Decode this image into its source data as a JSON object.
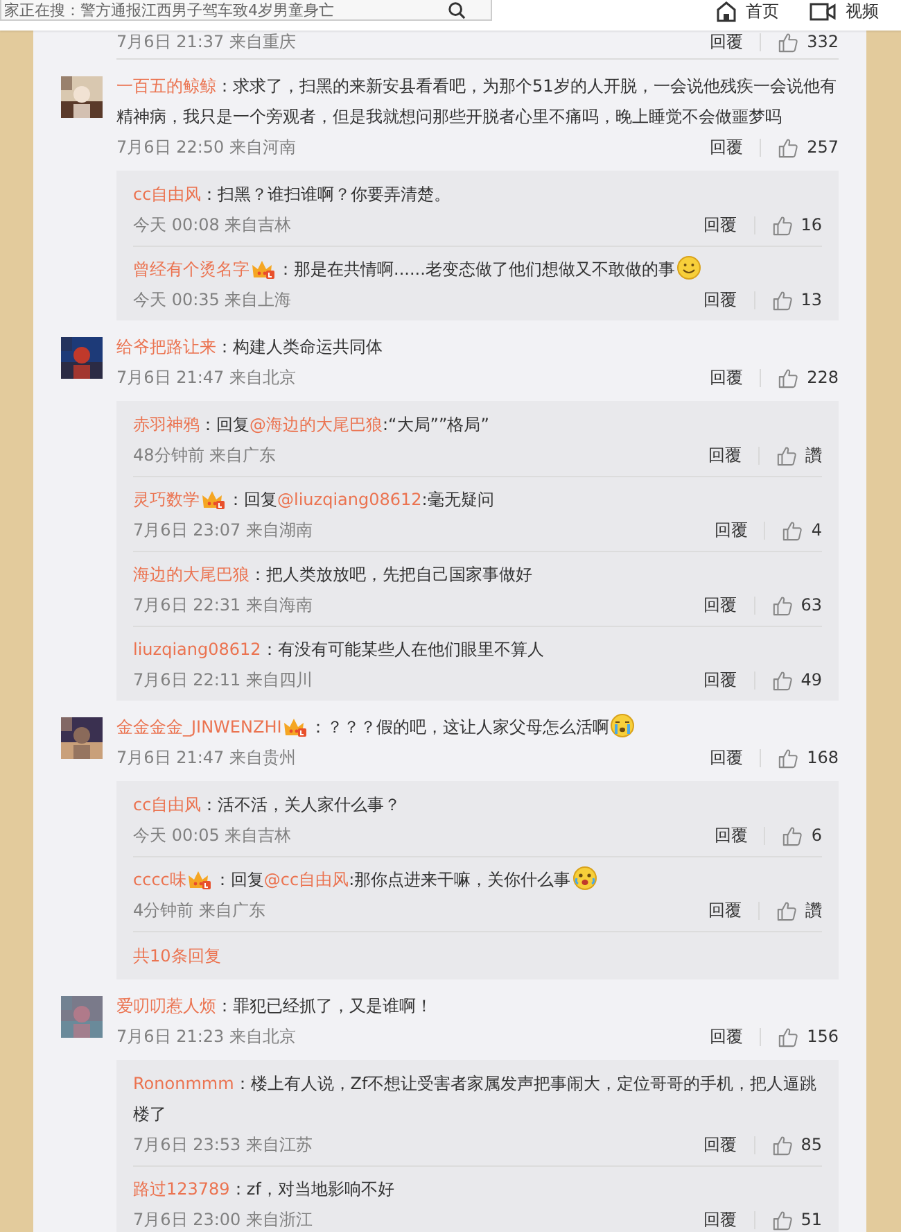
{
  "header": {
    "search": {
      "value": "家正在搜：警方通报江西男子驾车致4岁男童身亡"
    },
    "nav": [
      {
        "label": "首页"
      },
      {
        "label": "视频"
      }
    ]
  },
  "partial_comment": {
    "time": "7月6日 21:37 来自重庆",
    "reply": "回覆",
    "likes": "332"
  },
  "comments": [
    {
      "user": "一百五的鲸鲸",
      "parts": [
        {
          "kind": "plain",
          "text": "：求求了，扫黑的来新安县看看吧，为那个51岁的人开脱，一会说他残疾一会说他有精神病，我只是一个旁观者，但是我就想问那些开脱者心里不痛吗，晚上睡觉不会做噩梦吗"
        }
      ],
      "time": "7月6日 22:50 来自河南",
      "reply": "回覆",
      "likes": "257",
      "replies": [
        {
          "user": "cc自由风",
          "parts": [
            {
              "kind": "plain",
              "text": "：扫黑？谁扫谁啊？你要弄清楚。"
            }
          ],
          "time": "今天 00:08 来自吉林",
          "reply": "回覆",
          "likes": "16"
        },
        {
          "user": "曾经有个烫名字",
          "parts": [
            {
              "kind": "badge"
            },
            {
              "kind": "plain",
              "text": "：那是在共情啊......老变态做了他们想做又不敢做的事"
            },
            {
              "kind": "smiley"
            }
          ],
          "time": "今天 00:35 来自上海",
          "reply": "回覆",
          "likes": "13"
        }
      ]
    },
    {
      "user": "给爷把路让来",
      "parts": [
        {
          "kind": "plain",
          "text": "：构建人类命运共同体"
        }
      ],
      "time": "7月6日 21:47 来自北京",
      "reply": "回覆",
      "likes": "228",
      "replies": [
        {
          "user": "赤羽神鸦",
          "parts": [
            {
              "kind": "plain",
              "text": "：回复"
            },
            {
              "kind": "mention",
              "text": "@海边的大尾巴狼"
            },
            {
              "kind": "plain",
              "text": ":“大局””格局”"
            }
          ],
          "time": "48分钟前 来自广东",
          "reply": "回覆",
          "likes": "讚"
        },
        {
          "user": "灵巧数学",
          "parts": [
            {
              "kind": "badge"
            },
            {
              "kind": "plain",
              "text": "：回复"
            },
            {
              "kind": "mention",
              "text": "@liuzqiang08612"
            },
            {
              "kind": "plain",
              "text": ":毫无疑问"
            }
          ],
          "time": "7月6日 23:07 来自湖南",
          "reply": "回覆",
          "likes": "4"
        },
        {
          "user": "海边的大尾巴狼",
          "parts": [
            {
              "kind": "plain",
              "text": "：把人类放放吧，先把自己国家事做好"
            }
          ],
          "time": "7月6日 22:31 来自海南",
          "reply": "回覆",
          "likes": "63"
        },
        {
          "user": "liuzqiang08612",
          "parts": [
            {
              "kind": "plain",
              "text": "：有没有可能某些人在他们眼里不算人"
            }
          ],
          "time": "7月6日 22:11 来自四川",
          "reply": "回覆",
          "likes": "49"
        }
      ]
    },
    {
      "user": "金金金金_JINWENZHI",
      "parts": [
        {
          "kind": "badge"
        },
        {
          "kind": "plain",
          "text": "：？？？假的吧，这让人家父母怎么活啊"
        },
        {
          "kind": "crying"
        }
      ],
      "time": "7月6日 21:47 来自贵州",
      "reply": "回覆",
      "likes": "168",
      "replies": [
        {
          "user": "cc自由风",
          "parts": [
            {
              "kind": "plain",
              "text": "：活不活，关人家什么事？"
            }
          ],
          "time": "今天 00:05 来自吉林",
          "reply": "回覆",
          "likes": "6"
        },
        {
          "user": "cccc味",
          "parts": [
            {
              "kind": "badge"
            },
            {
              "kind": "plain",
              "text": "：回复"
            },
            {
              "kind": "mention",
              "text": "@cc自由风"
            },
            {
              "kind": "plain",
              "text": ":那你点进来干嘛，关你什么事"
            },
            {
              "kind": "tearful"
            }
          ],
          "time": "4分钟前 来自广东",
          "reply": "回覆",
          "likes": "讚"
        }
      ],
      "more": "共10条回复"
    },
    {
      "user": "爱叨叨惹人烦",
      "parts": [
        {
          "kind": "plain",
          "text": "：罪犯已经抓了，又是谁啊！"
        }
      ],
      "time": "7月6日 21:23 来自北京",
      "reply": "回覆",
      "likes": "156",
      "replies": [
        {
          "user": "Rononmmm",
          "parts": [
            {
              "kind": "plain",
              "text": "：楼上有人说，Zf不想让受害者家属发声把事闹大，定位哥哥的手机，把人逼跳楼了"
            }
          ],
          "time": "7月6日 23:53 来自江苏",
          "reply": "回覆",
          "likes": "85"
        },
        {
          "user": "路过123789",
          "parts": [
            {
              "kind": "plain",
              "text": "：zf，对当地影响不好"
            }
          ],
          "time": "7月6日 23:00 来自浙江",
          "reply": "回覆",
          "likes": "51"
        }
      ]
    }
  ]
}
